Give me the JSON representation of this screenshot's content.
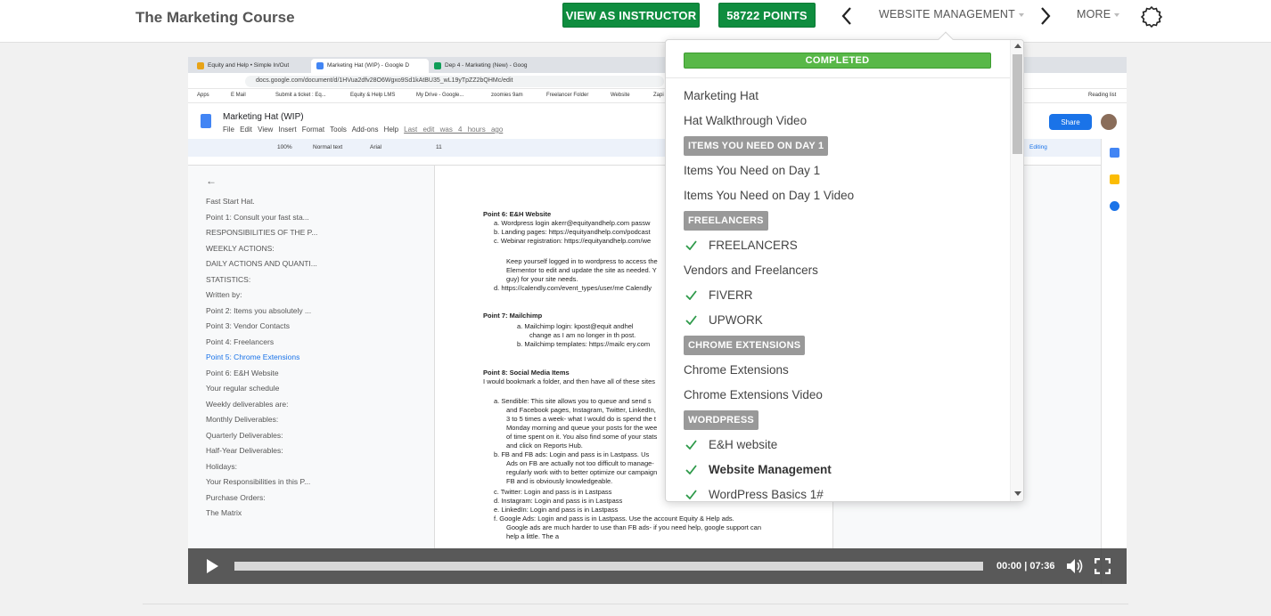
{
  "header": {
    "course_title": "The Marketing Course",
    "instructor_button": "VIEW AS INSTRUCTOR",
    "points_button": "58722 POINTS",
    "lesson_select": "WEBSITE MANAGEMENT",
    "more_menu": "MORE"
  },
  "colors": {
    "brand_green": "#0f8d3f",
    "completed_green": "#58b848",
    "section_gray": "#999999",
    "check_green": "#2e9a4a"
  },
  "dropdown": {
    "status": "COMPLETED",
    "items": [
      {
        "type": "lesson",
        "label": "Marketing Hat",
        "checked": false
      },
      {
        "type": "lesson",
        "label": "Hat Walkthrough Video",
        "checked": false
      },
      {
        "type": "section",
        "label": "ITEMS YOU NEED ON DAY 1"
      },
      {
        "type": "lesson",
        "label": "Items You Need on Day 1",
        "checked": false
      },
      {
        "type": "lesson",
        "label": "Items You Need on Day 1 Video",
        "checked": false
      },
      {
        "type": "section",
        "label": "FREELANCERS"
      },
      {
        "type": "lesson",
        "label": "FREELANCERS",
        "checked": true
      },
      {
        "type": "lesson",
        "label": "Vendors and Freelancers",
        "checked": false
      },
      {
        "type": "lesson",
        "label": "FIVERR",
        "checked": true
      },
      {
        "type": "lesson",
        "label": "UPWORK",
        "checked": true
      },
      {
        "type": "section",
        "label": "CHROME EXTENSIONS"
      },
      {
        "type": "lesson",
        "label": "Chrome Extensions",
        "checked": false
      },
      {
        "type": "lesson",
        "label": "Chrome Extensions Video",
        "checked": false
      },
      {
        "type": "section",
        "label": "WORDPRESS"
      },
      {
        "type": "lesson",
        "label": "E&H website",
        "checked": true
      },
      {
        "type": "lesson",
        "label": "Website Management",
        "checked": true,
        "current": true
      },
      {
        "type": "lesson",
        "label": "WordPress Basics 1#",
        "checked": true
      }
    ]
  },
  "video": {
    "time": "00:00 | 07:36",
    "browser": {
      "tabs": [
        "Equity and Help • Simple In/Out",
        "Marketing Hat (WIP) - Google D",
        "Dep 4 - Marketing (New) - Goog"
      ],
      "url": "docs.google.com/document/d/1HVua2dfv28O6Wgxo9Sd1kAtBU35_wL19yTpZZ2bQHMc/edit",
      "bookmarks": [
        "Apps",
        "E Mail",
        "Submit a ticket : Eq...",
        "Equity & Help LMS",
        "My Drive - Google...",
        "zoomies 9am",
        "Freelancer Folder",
        "Website",
        "Zapi"
      ],
      "reading_list": "Reading list"
    },
    "doc": {
      "title": "Marketing Hat (WIP)",
      "menu": "File  Edit  View  Insert  Format  Tools  Add-ons  Help",
      "last_edit": "Last edit was 4 hours ago",
      "share": "Share",
      "editing": "Editing",
      "zoom": "100%",
      "style": "Normal text",
      "font": "Arial",
      "font_size": "11",
      "outline": [
        "Fast Start Hat.",
        "Point 1: Consult your fast sta...",
        "RESPONSIBILITIES OF THE P...",
        "WEEKLY ACTIONS:",
        "DAILY ACTIONS AND QUANTI...",
        "STATISTICS:",
        "Written by:",
        "Point 2: Items you absolutely ...",
        "Point 3: Vendor Contacts",
        "Point 4: Freelancers",
        "Point 5: Chrome Extensions",
        "Point 6: E&H Website",
        "Your regular schedule",
        "Weekly deliverables are:",
        "Monthly Deliverables:",
        "Quarterly Deliverables:",
        "Half-Year Deliverables:",
        "Holidays:",
        "Your Responsibilities in this P...",
        "Purchase Orders:",
        "The Matrix"
      ],
      "lines": {
        "p6": "Point 6: E&H Website",
        "p6a": "a.   Wordpress login akerr@equityandhelp.com  passw",
        "p6b": "b.   Landing pages: https://equityandhelp.com/podcast",
        "p6c": "c.   Webinar registration: https://equityandhelp.com/we",
        "p6t1": "Keep yourself logged in to wordpress to access the",
        "p6t2": "Elementor to edit and update the site as needed. Y",
        "p6t3": "guy) for your site needs.",
        "p6d": "d.   https://calendly.com/event_types/user/me  Calendly",
        "p7": "Point 7:  Mailchimp",
        "p7a": "a.   Mailchimp login: kpost@equit  andhel",
        "p7a2": "change as I am no longer in th  post.",
        "p7b": "b.   Mailchimp templates: https://mailc  ery.com",
        "p8": "Point 8:  Social Media Items",
        "p8i": "I would bookmark a folder, and then have all of these sites",
        "p8a": "a.   Sendible: This site allows you to queue and send s",
        "p8a2": "and Facebook pages, Instagram, Twitter, LinkedIn,",
        "p8a3": "3 to 5 times a week- what I would do is spend the t",
        "p8a4": "Monday morning and queue your posts for the wee",
        "p8a5": "of time spent on it. You also find some of your stats",
        "p8a6": "and click on Reports Hub.",
        "p8b": "b.   FB and FB ads: Login and pass is in Lastpass. Us",
        "p8b2": "Ads on FB are actually not too difficult to manage-",
        "p8b3": "regularly work with to better optimize our campaign",
        "p8b4": "FB and is obviously knowledgeable.",
        "p8c": "c.   Twitter: Login and pass is in Lastpass",
        "p8d": "d.   Instagram: Login and pass is in Lastpass",
        "p8e": "e.   LinkedIn: Login and pass is in Lastpass",
        "p8f": "f.   Google Ads: Login and pass is in Lastpass. Use the account Equity & Help ads.",
        "p8f2": "Google ads are much harder to use than FB ads- if you need help, google support can",
        "p8f3": "help a little. The a"
      }
    }
  }
}
